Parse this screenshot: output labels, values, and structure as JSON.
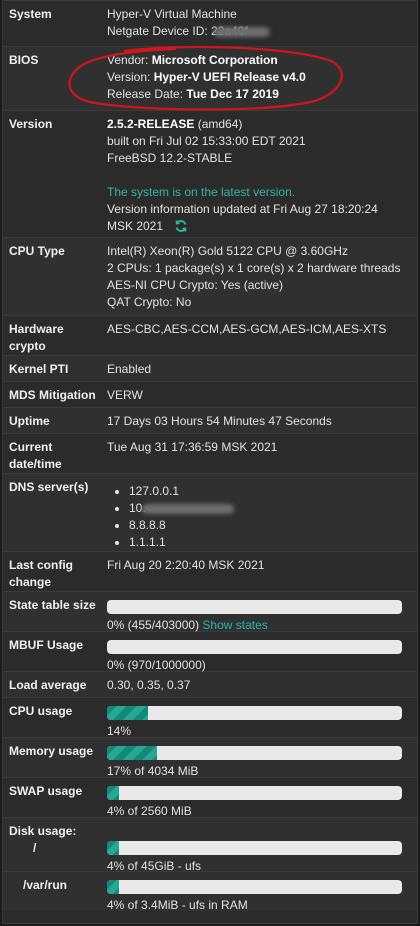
{
  "system": {
    "label": "System",
    "line1": "Hyper-V Virtual Machine",
    "line2": "Netgate Device ID: 22a40f"
  },
  "bios": {
    "label": "BIOS",
    "vendor_key": "Vendor: ",
    "vendor_val": "Microsoft Corporation",
    "version_key": "Version: ",
    "version_val": "Hyper-V UEFI Release v4.0",
    "date_key": "Release Date: ",
    "date_val": "Tue Dec 17 2019"
  },
  "version": {
    "label": "Version",
    "release": "2.5.2-RELEASE",
    "arch": " (amd64)",
    "built": "built on Fri Jul 02 15:33:00 EDT 2021",
    "os": "FreeBSD 12.2-STABLE",
    "status": "The system is on the latest version.",
    "updated1": "Version information updated at Fri Aug 27 18:20:24",
    "updated2": "MSK 2021"
  },
  "cpu": {
    "label": "CPU Type",
    "l1": "Intel(R) Xeon(R) Gold 5122 CPU @ 3.60GHz",
    "l2": "2 CPUs: 1 package(s) x 1 core(s) x 2 hardware threads",
    "l3": "AES-NI CPU Crypto: Yes (active)",
    "l4": "QAT Crypto: No"
  },
  "hw_crypto": {
    "label1": "Hardware",
    "label2": "crypto",
    "value": "AES-CBC,AES-CCM,AES-GCM,AES-ICM,AES-XTS"
  },
  "kernel_pti": {
    "label": "Kernel PTI",
    "value": "Enabled"
  },
  "mds": {
    "label": "MDS Mitigation",
    "value": "VERW"
  },
  "uptime": {
    "label": "Uptime",
    "value": "17 Days 03 Hours 54 Minutes 47 Seconds"
  },
  "datetime": {
    "label1": "Current",
    "label2": "date/time",
    "value": "Tue Aug 31 17:36:59 MSK 2021"
  },
  "dns": {
    "label": "DNS server(s)",
    "servers": [
      "127.0.0.1",
      "10.",
      "8.8.8.8",
      "1.1.1.1"
    ]
  },
  "last_config": {
    "label1": "Last config",
    "label2": "change",
    "value": "Fri Aug 20 2:20:40 MSK 2021"
  },
  "state_table": {
    "label": "State table size",
    "percent": 0,
    "text": "0% (455/403000)",
    "link": "Show states"
  },
  "mbuf": {
    "label": "MBUF Usage",
    "percent": 0,
    "text": "0% (970/1000000)"
  },
  "load": {
    "label": "Load average",
    "value": "0.30, 0.35, 0.37"
  },
  "cpu_usage": {
    "label": "CPU usage",
    "percent": 14,
    "text": "14%"
  },
  "memory": {
    "label": "Memory usage",
    "percent": 17,
    "text": "17% of 4034 MiB"
  },
  "swap": {
    "label": "SWAP usage",
    "percent": 4,
    "text": "4% of 2560 MiB"
  },
  "disk": {
    "label": "Disk usage:",
    "root_label": "/",
    "root_percent": 4,
    "root_text": "4% of 45GiB - ufs",
    "var_label": "/var/run",
    "var_percent": 4,
    "var_text": "4% of 3.4MiB - ufs in RAM"
  },
  "colors": {
    "accent": "#2bb8a5",
    "annotation": "#d0161c"
  }
}
